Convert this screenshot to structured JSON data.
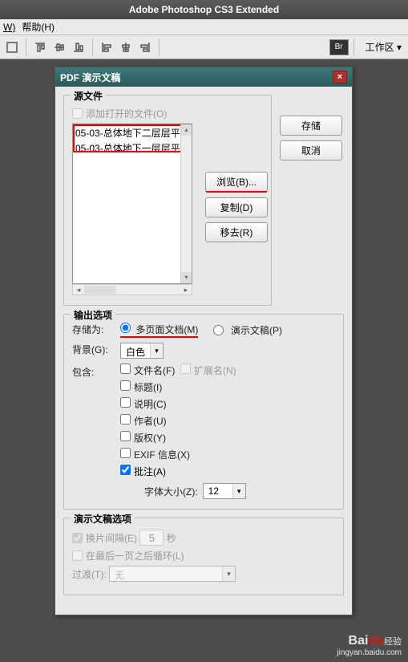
{
  "app": {
    "title": "Adobe Photoshop CS3 Extended"
  },
  "menu": {
    "window": "W)",
    "help": "帮助(H)"
  },
  "toolbar": {
    "br": "Br",
    "work_area": "工作区 ▾"
  },
  "dialog": {
    "title": "PDF 演示文稿",
    "save": "存储",
    "cancel": "取消",
    "close": "×"
  },
  "source": {
    "legend": "源文件",
    "add_open": "添加打开的文件(O)",
    "items": [
      "05-03-总体地下二层层平",
      "05-03-总体地下一层层平"
    ],
    "browse": "浏览(B)...",
    "dup": "复制(D)",
    "remove": "移去(R)"
  },
  "output": {
    "legend": "输出选项",
    "save_as": "存储为:",
    "multi": "多页面文档(M)",
    "pres": "演示文稿(P)",
    "bg": "背景(G):",
    "bg_val": "白色",
    "include": "包含:",
    "filename": "文件名(F)",
    "ext": "扩展名(N)",
    "title": "标题(I)",
    "desc": "说明(C)",
    "author": "作者(U)",
    "copyright": "版权(Y)",
    "exif": "EXIF 信息(X)",
    "annot": "批注(A)",
    "fontsize": "字体大小(Z):",
    "fontsize_val": "12"
  },
  "pres": {
    "legend": "演示文稿选项",
    "interval": "换片间隔(E)",
    "interval_val": "5",
    "seconds": "秒",
    "loop": "在最后一页之后循环(L)",
    "trans": "过渡(T):",
    "trans_val": "无"
  },
  "watermark": {
    "brand": "Bai",
    "du": "du",
    "exp": "经验",
    "url": "jingyan.baidu.com"
  }
}
